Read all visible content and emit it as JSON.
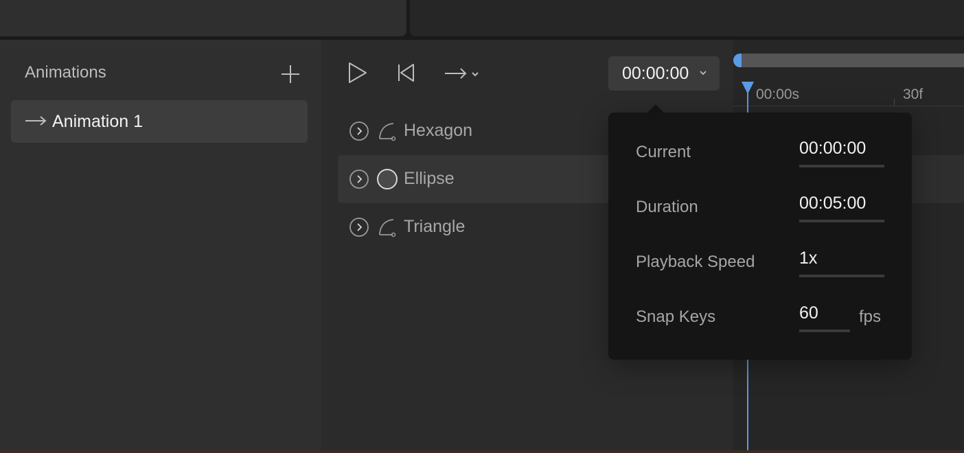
{
  "colors": {
    "accent": "#5b9be6",
    "panel": "#2f2f2f",
    "popover": "#151515"
  },
  "animations_panel": {
    "title": "Animations",
    "add_icon": "plus-icon",
    "items": [
      {
        "label": "Animation 1",
        "icon": "arrow-right-icon"
      }
    ]
  },
  "toolbar": {
    "play_icon": "play-icon",
    "rewind_icon": "skip-to-start-icon",
    "loop_icon": "arrow-right-dropdown-icon",
    "time_display": "00:00:00"
  },
  "layers": [
    {
      "name": "Hexagon",
      "icon": "path-curve-icon"
    },
    {
      "name": "Ellipse",
      "icon": "circle-icon"
    },
    {
      "name": "Triangle",
      "icon": "path-curve-icon"
    }
  ],
  "timeline": {
    "ruler_labels": [
      "00:00s",
      "30f"
    ]
  },
  "time_popover": {
    "current": {
      "label": "Current",
      "value": "00:00:00"
    },
    "duration": {
      "label": "Duration",
      "value": "00:05:00"
    },
    "speed": {
      "label": "Playback Speed",
      "value": "1x"
    },
    "snap": {
      "label": "Snap Keys",
      "value": "60",
      "unit": "fps"
    }
  }
}
